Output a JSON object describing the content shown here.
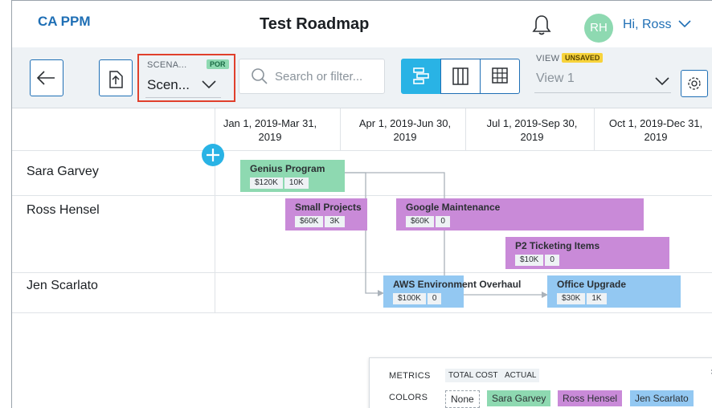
{
  "header": {
    "brand": "CA PPM",
    "title": "Test Roadmap",
    "avatar_initials": "RH",
    "greeting": "Hi, Ross"
  },
  "toolbar": {
    "scenario_label": "SCENA...",
    "scenario_badge": "POR",
    "scenario_value": "Scen...",
    "search_placeholder": "Search or filter...",
    "view_label": "VIEW",
    "view_badge": "UNSAVED",
    "view_value": "View 1",
    "active_view_mode": "timeline"
  },
  "timeline": {
    "periods": [
      {
        "line1": "Jan 1, 2019-Mar 31,",
        "line2": "2019"
      },
      {
        "line1": "Apr 1, 2019-Jun 30,",
        "line2": "2019"
      },
      {
        "line1": "Jul 1, 2019-Sep 30,",
        "line2": "2019"
      },
      {
        "line1": "Oct 1, 2019-Dec 31,",
        "line2": "2019"
      }
    ],
    "owners": [
      "Sara Garvey",
      "Ross Hensel",
      "Jen Scarlato"
    ],
    "items": [
      {
        "name": "Genius Program",
        "cost": "$120K",
        "actual": "10K",
        "owner": "Sara Garvey"
      },
      {
        "name": "Small Projects",
        "cost": "$60K",
        "actual": "3K",
        "owner": "Ross Hensel"
      },
      {
        "name": "Google Maintenance",
        "cost": "$60K",
        "actual": "0",
        "owner": "Ross Hensel"
      },
      {
        "name": "P2 Ticketing Items",
        "cost": "$10K",
        "actual": "0",
        "owner": "Ross Hensel"
      },
      {
        "name": "AWS Environment Overhaul",
        "cost": "$100K",
        "actual": "0",
        "owner": "Jen Scarlato"
      },
      {
        "name": "Office Upgrade",
        "cost": "$30K",
        "actual": "1K",
        "owner": "Jen Scarlato"
      }
    ]
  },
  "legend": {
    "metrics_label": "METRICS",
    "metrics": [
      "TOTAL COST",
      "ACTUAL"
    ],
    "colors_label": "COLORS",
    "colors": [
      {
        "label": "None",
        "color": "#ffffff"
      },
      {
        "label": "Sara Garvey",
        "color": "#8ed9b1"
      },
      {
        "label": "Ross Hensel",
        "color": "#c98ad8"
      },
      {
        "label": "Jen Scarlato",
        "color": "#93c8f2"
      }
    ]
  },
  "colors": {
    "brand": "#1f6fb5",
    "accent": "#29b3e5",
    "highlight_border": "#e0402c"
  }
}
